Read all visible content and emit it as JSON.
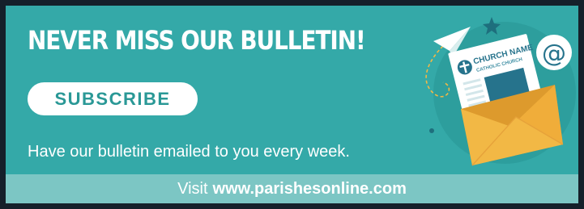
{
  "headline": "NEVER MISS OUR BULLETIN!",
  "subscribe_label": "SUBSCRIBE",
  "tagline": "Have our bulletin emailed to you every week.",
  "footer": {
    "prefix": "Visit",
    "url": "www.parishesonline.com"
  },
  "illustration": {
    "doc_title": "CHURCH NAME",
    "doc_subtitle": "CATHOLIC CHURCH",
    "email_symbol": "@"
  },
  "colors": {
    "background": "#34a9a8",
    "footer_bar": "#7cc6c4",
    "frame": "#15202a",
    "button_text": "#2a9896",
    "envelope": "#f2b845",
    "envelope_dark": "#dd9a2d",
    "document_accent": "#26738c"
  },
  "icons": [
    "paper-plane-icon",
    "star-icon",
    "email-at-icon",
    "envelope-icon",
    "bulletin-document-icon",
    "church-logo-icon"
  ]
}
